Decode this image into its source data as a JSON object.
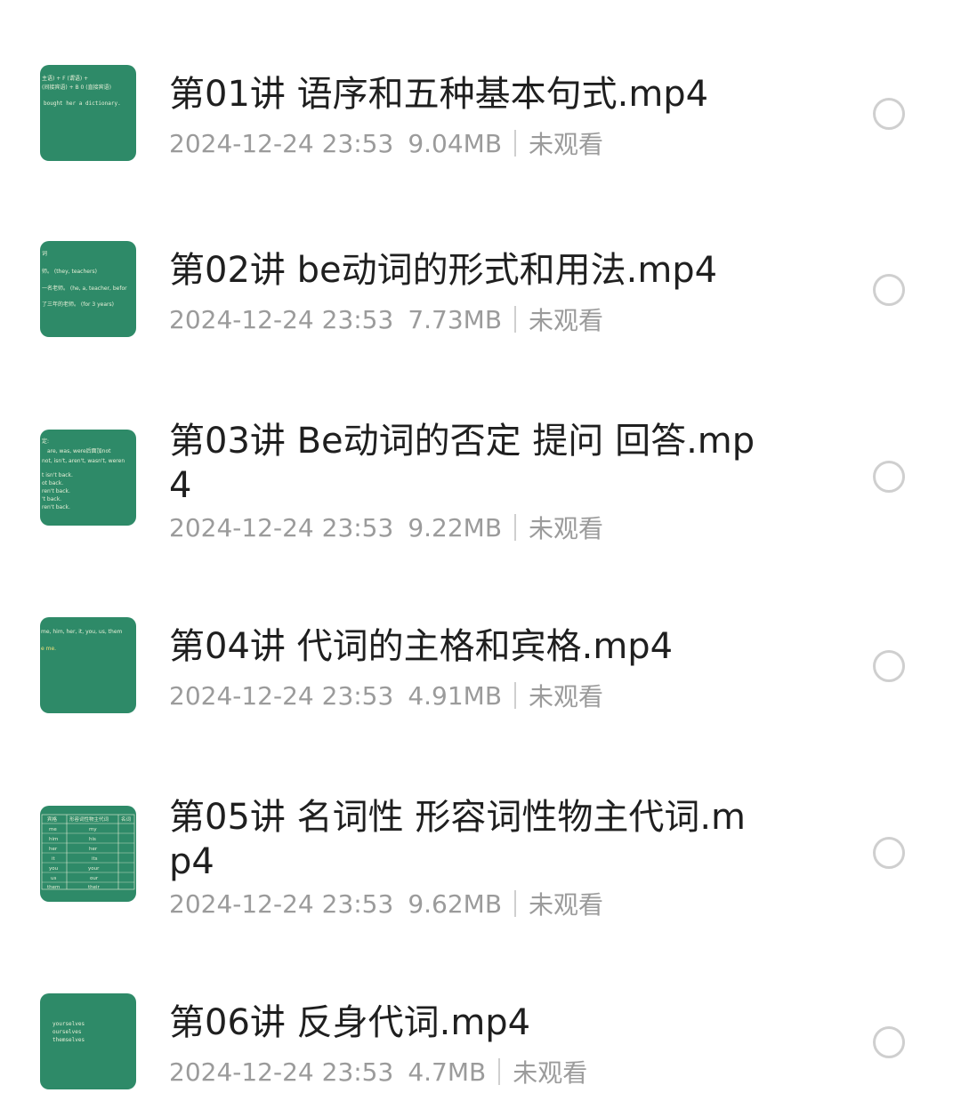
{
  "files": [
    {
      "title": "第01讲 语序和五种基本句式.mp4",
      "date": "2024-12-24 23:53",
      "size": "9.04MB",
      "status": "未观看",
      "thumbnail_lines": [
        "主语) + F (谓语) +",
        "(间接宾语) + B 0 (直接宾语)",
        "bought her a dictionary."
      ]
    },
    {
      "title": "第02讲 be动词的形式和用法.mp4",
      "date": "2024-12-24 23:53",
      "size": "7.73MB",
      "status": "未观看",
      "thumbnail_lines": [
        "词",
        "师。 (they, teachers)",
        "一名老师。 (he, a, teacher, befor",
        "了三年的老师。 (for 3 years)"
      ]
    },
    {
      "title": "第03讲 Be动词的否定 提问 回答.mp4",
      "date": "2024-12-24 23:53",
      "size": "9.22MB",
      "status": "未观看",
      "thumbnail_lines": [
        "定:",
        "are, was, were后面加not",
        "not, isn't, aren't, wasn't, weren",
        "t isn't back.",
        "ot back.",
        "ren't back.",
        "'t back.",
        "ren't back."
      ]
    },
    {
      "title": "第04讲 代词的主格和宾格.mp4",
      "date": "2024-12-24 23:53",
      "size": "4.91MB",
      "status": "未观看",
      "thumbnail_lines": [
        "me, him, her, it, you, us, them",
        "e me."
      ]
    },
    {
      "title": "第05讲 名词性 形容词性物主代词.mp4",
      "date": "2024-12-24 23:53",
      "size": "9.62MB",
      "status": "未观看",
      "thumbnail_table": {
        "headers": [
          "宾格",
          "形容词性物主代词",
          "名词"
        ],
        "rows": [
          [
            "me",
            "my"
          ],
          [
            "him",
            "his"
          ],
          [
            "her",
            "her"
          ],
          [
            "it",
            "its"
          ],
          [
            "you",
            "your"
          ],
          [
            "us",
            "our"
          ],
          [
            "them",
            "their"
          ]
        ]
      }
    },
    {
      "title": "第06讲 反身代词.mp4",
      "date": "2024-12-24 23:53",
      "size": "4.7MB",
      "status": "未观看",
      "thumbnail_lines": [
        "yourselves",
        "ourselves",
        "themselves"
      ]
    }
  ],
  "colors": {
    "thumbnail_green": "#2e8a68",
    "title_text": "#1f1f1f",
    "meta_text": "#9b9b9b",
    "radio_border": "#cfcfcf"
  }
}
